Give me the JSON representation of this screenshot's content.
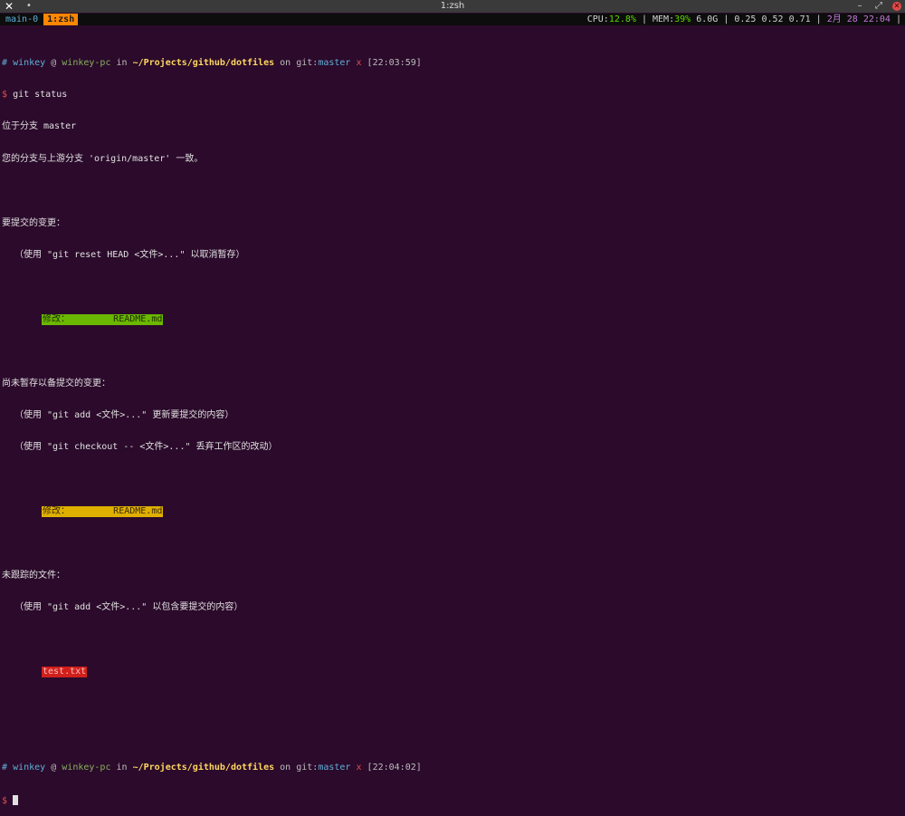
{
  "window": {
    "title": "1:zsh"
  },
  "tmux": {
    "tabs": [
      {
        "label": "main-0",
        "active": false
      },
      {
        "label": "1:zsh",
        "active": true
      }
    ],
    "status": {
      "cpu_label": "CPU:",
      "cpu_value": "12.8%",
      "mem_label": "MEM:",
      "mem_value": "39%",
      "mem_total": "6.0G",
      "load": "0.25 0.52 0.71",
      "date_prefix": "2月",
      "date_rest": "28 22:04"
    }
  },
  "prompt1": {
    "hash": "#",
    "user": "winkey",
    "at": "@",
    "host": "winkey-pc",
    "in": "in",
    "path": "~/Projects/github/dotfiles",
    "on": "on",
    "git": "git:",
    "branch": "master",
    "dirty": "x",
    "time": "[22:03:59]",
    "symbol": "$",
    "command": "git status"
  },
  "status": {
    "branch_line": "位于分支 master",
    "upstream_line": "您的分支与上游分支 'origin/master' 一致。",
    "staged_header": "要提交的变更：",
    "staged_hint": "（使用 \"git reset HEAD <文件>...\" 以取消暂存）",
    "staged_label": "修改：",
    "staged_file": "README.md",
    "unstaged_header": "尚未暂存以备提交的变更：",
    "unstaged_hint1": "（使用 \"git add <文件>...\" 更新要提交的内容）",
    "unstaged_hint2": "（使用 \"git checkout -- <文件>...\" 丢弃工作区的改动）",
    "unstaged_label": "修改：",
    "unstaged_file": "README.md",
    "untracked_header": "未跟踪的文件：",
    "untracked_hint": "（使用 \"git add <文件>...\" 以包含要提交的内容）",
    "untracked_file": "test.txt"
  },
  "prompt2": {
    "hash": "#",
    "user": "winkey",
    "at": "@",
    "host": "winkey-pc",
    "in": "in",
    "path": "~/Projects/github/dotfiles",
    "on": "on",
    "git": "git:",
    "branch": "master",
    "dirty": "x",
    "time": "[22:04:02]",
    "symbol": "$"
  }
}
